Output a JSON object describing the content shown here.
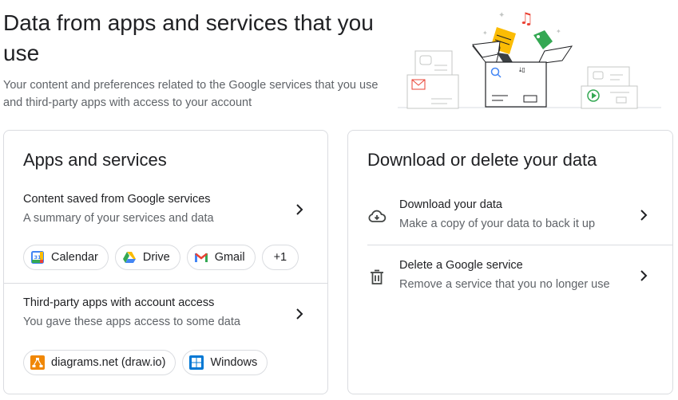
{
  "header": {
    "title": "Data from apps and services that you use",
    "subtitle": "Your content and preferences related to the Google services that you use and third-party apps with access to your account"
  },
  "apps_card": {
    "title": "Apps and services",
    "content_row": {
      "title": "Content saved from Google services",
      "subtitle": "A summary of your services and data"
    },
    "service_chips": [
      {
        "label": "Calendar",
        "icon": "calendar-icon"
      },
      {
        "label": "Drive",
        "icon": "drive-icon"
      },
      {
        "label": "Gmail",
        "icon": "gmail-icon"
      },
      {
        "label": "+1"
      }
    ],
    "third_party_row": {
      "title": "Third-party apps with account access",
      "subtitle": "You gave these apps access to some data"
    },
    "app_chips": [
      {
        "label": "diagrams.net (draw.io)",
        "icon": "drawio-icon"
      },
      {
        "label": "Windows",
        "icon": "windows-icon"
      }
    ]
  },
  "data_card": {
    "title": "Download or delete your data",
    "download_row": {
      "title": "Download your data",
      "subtitle": "Make a copy of your data to back it up",
      "icon": "cloud-download-icon"
    },
    "delete_row": {
      "title": "Delete a Google service",
      "subtitle": "Remove a service that you no longer use",
      "icon": "trash-icon"
    }
  },
  "colors": {
    "text_primary": "#202124",
    "text_secondary": "#5f6368",
    "border": "#dadce0",
    "google_blue": "#4285f4",
    "google_red": "#ea4335",
    "google_yellow": "#fbbc04",
    "google_green": "#34a853"
  }
}
